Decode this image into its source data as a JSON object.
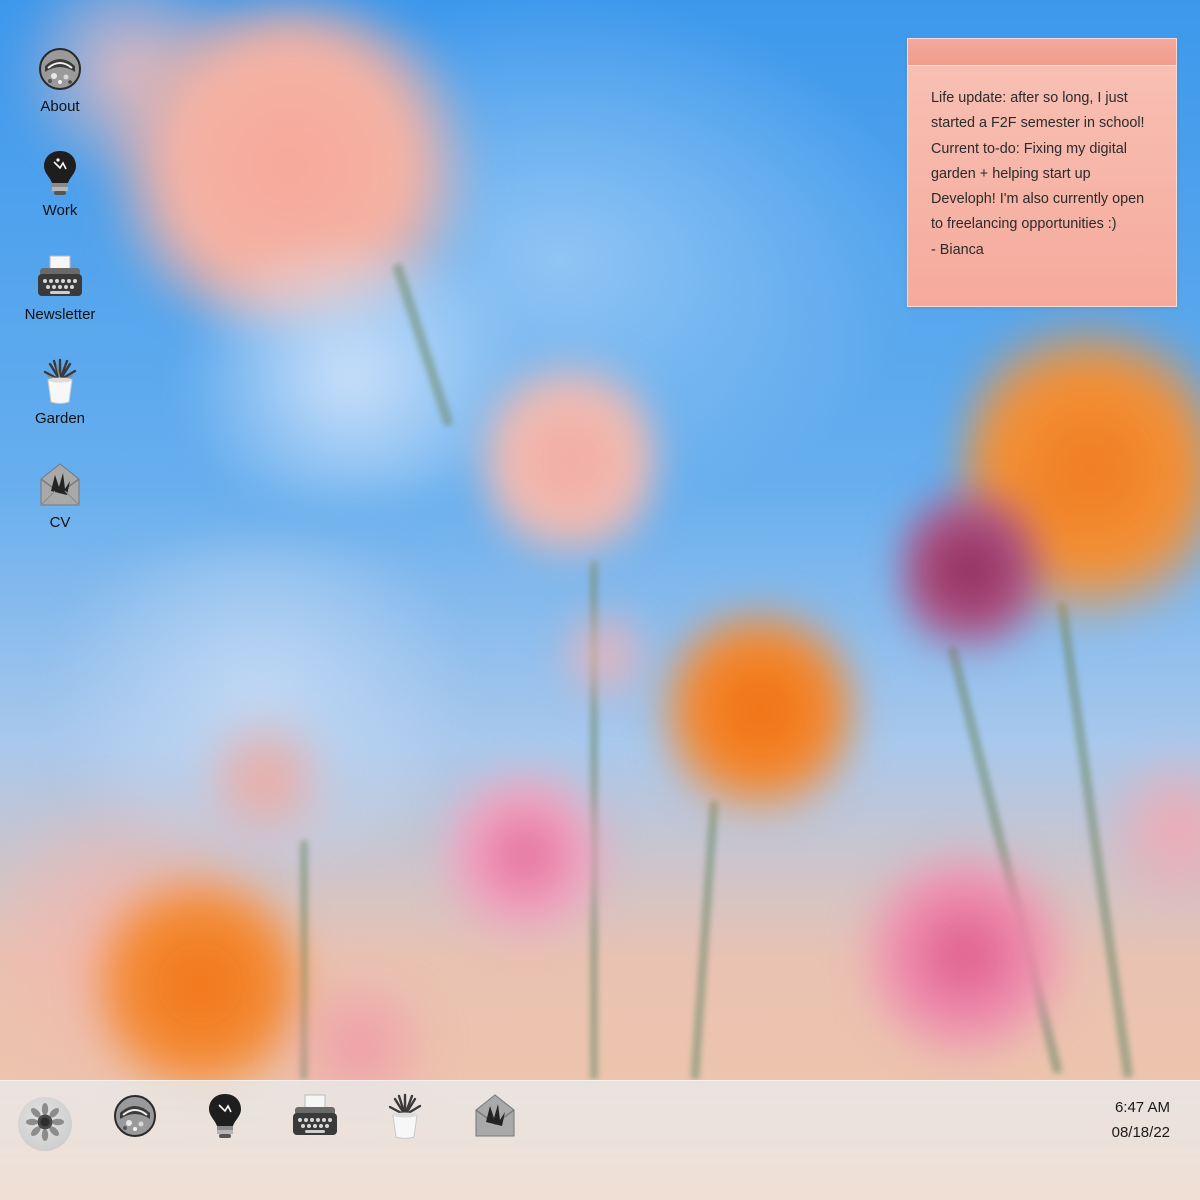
{
  "desktop": {
    "icons": [
      {
        "label": "About",
        "icon": "astronaut-helmet-icon"
      },
      {
        "label": "Work",
        "icon": "lightbulb-icon"
      },
      {
        "label": "Newsletter",
        "icon": "typewriter-icon"
      },
      {
        "label": "Garden",
        "icon": "potted-plant-icon"
      },
      {
        "label": "CV",
        "icon": "envelope-icon"
      }
    ]
  },
  "sticky_note": {
    "lines": [
      "Life update: after so long, I just",
      "started a F2F semester in school!",
      "Current to-do: Fixing my digital",
      "garden + helping start up",
      "Developh! I'm also currently open",
      "to freelancing opportunities :)",
      "- Bianca"
    ]
  },
  "taskbar": {
    "start_icon": "sunflower-icon",
    "items": [
      {
        "icon": "astronaut-helmet-icon"
      },
      {
        "icon": "lightbulb-icon"
      },
      {
        "icon": "typewriter-icon"
      },
      {
        "icon": "potted-plant-icon"
      },
      {
        "icon": "envelope-icon"
      }
    ],
    "time": "6:47 AM",
    "date": "08/18/22"
  },
  "colors": {
    "sticky_note": "#f5aa9c",
    "sticky_bar": "#f29c8d",
    "taskbar": "#e8ecee"
  }
}
